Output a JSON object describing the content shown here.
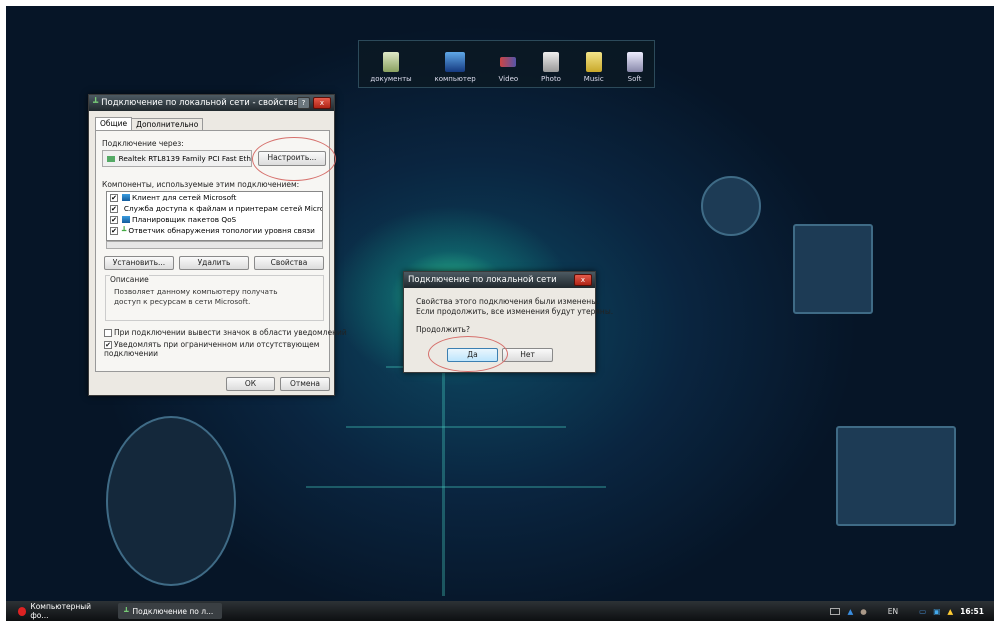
{
  "dock": {
    "items": [
      {
        "label": "документы",
        "icon": "document-icon"
      },
      {
        "label": "компьютер",
        "icon": "monitor-icon"
      },
      {
        "label": "Video",
        "icon": "video-icon"
      },
      {
        "label": "Photo",
        "icon": "camera-icon"
      },
      {
        "label": "Music",
        "icon": "folder-icon"
      },
      {
        "label": "Soft",
        "icon": "software-icon"
      }
    ]
  },
  "props": {
    "title": "Подключение по локальной сети - свойства",
    "help": "?",
    "close": "x",
    "tabs": [
      "Общие",
      "Дополнительно"
    ],
    "connect_via_label": "Подключение через:",
    "adapter": "Realtek RTL8139 Family PCI Fast Eth",
    "configure": "Настроить...",
    "components_label": "Компоненты, используемые этим подключением:",
    "components": [
      "Клиент для сетей Microsoft",
      "Служба доступа к файлам и принтерам сетей Micro",
      "Планировщик пакетов QoS",
      "Ответчик обнаружения топологии уровня связи"
    ],
    "install": "Установить...",
    "remove": "Удалить",
    "properties": "Свойства",
    "description_label": "Описание",
    "description": "Позволяет данному компьютеру получать доступ к ресурсам в сети Microsoft.",
    "show_icon": "При подключении вывести значок в области уведомлений",
    "notify": "Уведомлять при ограниченном или отсутствующем подключении",
    "ok": "ОК",
    "cancel": "Отмена"
  },
  "confirm": {
    "title": "Подключение по локальной сети",
    "close": "x",
    "message1": "Свойства этого подключения были изменены.",
    "message2": "Если продолжить, все изменения будут утеряны.",
    "question": "Продолжить?",
    "yes": "Да",
    "no": "Нет"
  },
  "taskbar": {
    "items": [
      "Компьютерный фо...",
      "Подключение по л..."
    ],
    "lang": "EN",
    "clock": "16:51"
  }
}
